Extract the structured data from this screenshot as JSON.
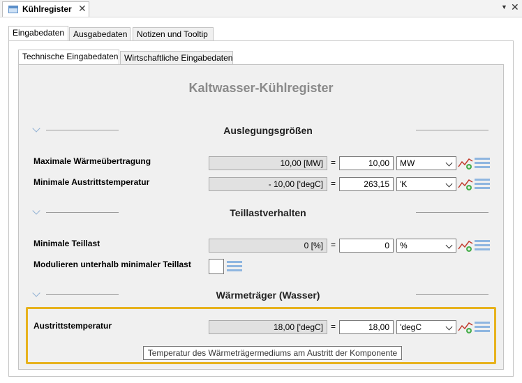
{
  "window": {
    "doc_tab_title": "Kühlregister",
    "close_symbol": "✕",
    "menu_symbol": "▼",
    "win_close_symbol": "✕"
  },
  "tabs": {
    "outer": [
      "Eingabedaten",
      "Ausgabedaten",
      "Notizen und Tooltip"
    ],
    "inner": [
      "Technische Eingabedaten",
      "Wirtschaftliche Eingabedaten"
    ]
  },
  "form": {
    "title": "Kaltwasser-Kühlregister",
    "sections": [
      {
        "title": "Auslegungsgrößen"
      },
      {
        "title": "Teillastverhalten"
      },
      {
        "title": "Wärmeträger (Wasser)"
      }
    ],
    "fields": [
      {
        "label": "Maximale Wärmeübertragung",
        "display": "10,00 [MW]",
        "eq": "=",
        "value": "10,00",
        "unit": "MW"
      },
      {
        "label": "Minimale Austrittstemperatur",
        "display": "- 10,00 ['degC]",
        "eq": "=",
        "value": "263,15",
        "unit": "'K"
      },
      {
        "label": "Minimale Teillast",
        "display": "0 [%]",
        "eq": "=",
        "value": "0",
        "unit": "%"
      },
      {
        "label": "Modulieren unterhalb minimaler Teillast"
      },
      {
        "label": "Austrittstemperatur",
        "display": "18,00 ['degC]",
        "eq": "=",
        "value": "18,00",
        "unit": "'degC"
      }
    ],
    "tooltip": "Temperatur des Wärmeträgermediums am Austritt der Komponente"
  },
  "colors": {
    "highlight": "#e7b21d",
    "title_gray": "#8a8a8a",
    "icon_blue": "#8fb6e0"
  },
  "icons": [
    "document-icon",
    "chart-icon",
    "list-icon",
    "chevron-down-icon"
  ]
}
